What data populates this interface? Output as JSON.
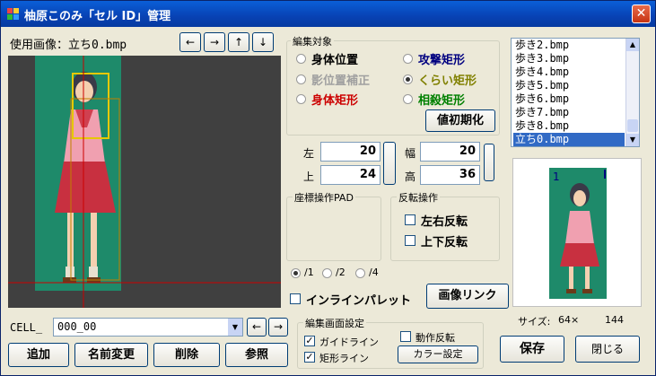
{
  "window": {
    "title": "柚原このみ「セル ID」管理"
  },
  "image_label": "使用画像：立ち0.bmp",
  "arrows": {
    "left": "←",
    "right": "→",
    "up": "↑",
    "down": "↓"
  },
  "edit_target": {
    "label": "編集対象",
    "options": [
      {
        "label": "身体位置",
        "color": "#000000",
        "checked": false
      },
      {
        "label": "影位置補正",
        "color": "#a0a0a0",
        "checked": false
      },
      {
        "label": "身体矩形",
        "color": "#cc0000",
        "checked": false
      },
      {
        "label": "攻撃矩形",
        "color": "#000080",
        "checked": false
      },
      {
        "label": "くらい矩形",
        "color": "#808000",
        "checked": true
      },
      {
        "label": "相殺矩形",
        "color": "#008000",
        "checked": false
      }
    ],
    "reset_label": "値初期化"
  },
  "rect_fields": {
    "left_label": "左",
    "left_value": "20",
    "top_label": "上",
    "top_value": "24",
    "width_label": "幅",
    "width_value": "20",
    "height_label": "高",
    "height_value": "36"
  },
  "pad_label": "座標操作PAD",
  "flip": {
    "label": "反転操作",
    "horizontal": "左右反転",
    "vertical": "上下反転"
  },
  "scale": {
    "options": [
      "/1",
      "/2",
      "/4"
    ],
    "selected": "/1"
  },
  "inline_palette": "インラインパレット",
  "image_link": "画像リンク",
  "file_list": [
    "歩き2.bmp",
    "歩き3.bmp",
    "歩き4.bmp",
    "歩き5.bmp",
    "歩き6.bmp",
    "歩き7.bmp",
    "歩き8.bmp",
    "立ち0.bmp"
  ],
  "selected_file": "立ち0.bmp",
  "preview": {
    "marker": "1"
  },
  "size_label": "サイズ:",
  "size_width": "64×",
  "size_height": "144",
  "cell": {
    "label": "CELL_",
    "value": "000_00"
  },
  "actions": {
    "add": "追加",
    "rename": "名前変更",
    "delete": "削除",
    "browse": "参照"
  },
  "display_settings": {
    "label": "編集画面設定",
    "guideline": "ガイドライン",
    "guideline_checked": true,
    "rect_line": "矩形ライン",
    "rect_line_checked": true,
    "motion_flip": "動作反転",
    "motion_flip_checked": false,
    "color_settings": "カラー設定"
  },
  "save": "保存",
  "close": "閉じる",
  "colors": {
    "title_bar": "#0842b4",
    "canvas_bg": "#404040",
    "sprite_bg": "#1e8a6a",
    "guide_line": "#cc0000",
    "rect_yellow": "#e6c800"
  }
}
